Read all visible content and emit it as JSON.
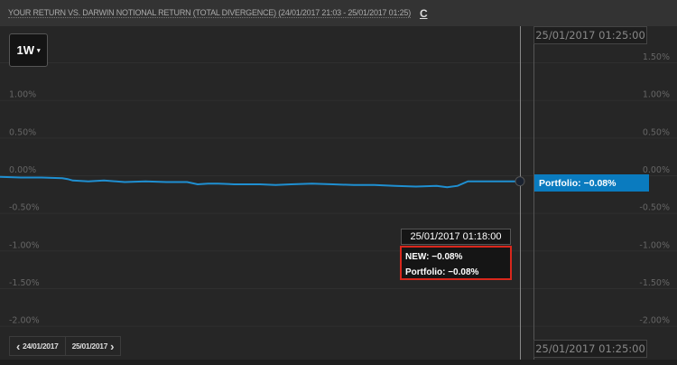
{
  "header": {
    "title": "YOUR RETURN VS. DARWIN NOTIONAL RETURN (TOTAL DIVERGENCE) (24/01/2017 21:03 - 25/01/2017 01:25)",
    "refresh_icon": "C"
  },
  "range_button": {
    "label": "1W",
    "caret": "▾"
  },
  "crosshair": {
    "date_top": "25/01/2017 01:25:00",
    "date_bottom": "25/01/2017 01:25:00",
    "badge": "Portfolio: −0.08%"
  },
  "tooltip": {
    "date": "25/01/2017 01:18:00",
    "new": "NEW: −0.08%",
    "portfolio": "Portfolio: −0.08%"
  },
  "nav": {
    "prev": "24/01/2017",
    "next": "25/01/2017",
    "prev_icon": "‹",
    "next_icon": "›"
  },
  "colors": {
    "line": "#1f8fd1",
    "badge": "#0a7bbf",
    "tooltip_border": "#d9271c"
  },
  "chart_data": {
    "type": "line",
    "title": "YOUR RETURN VS. DARWIN NOTIONAL RETURN (TOTAL DIVERGENCE)",
    "ylim": [
      -2.0,
      1.5
    ],
    "left_ticks": [
      "1.00%",
      "0.50%",
      "0.00%",
      "-0.50%",
      "-1.00%",
      "-1.50%",
      "-2.00%"
    ],
    "right_ticks": [
      "1.50%",
      "1.00%",
      "0.50%",
      "0.00%",
      "-0.50%",
      "-1.00%",
      "-1.50%",
      "-2.00%"
    ],
    "tick_values": [
      1.5,
      1.0,
      0.5,
      0.0,
      -0.5,
      -1.0,
      -1.5,
      -2.0
    ],
    "series": [
      {
        "name": "Portfolio",
        "x": [
          0,
          0.04,
          0.08,
          0.12,
          0.13,
          0.14,
          0.17,
          0.2,
          0.24,
          0.28,
          0.32,
          0.36,
          0.38,
          0.4,
          0.42,
          0.45,
          0.5,
          0.53,
          0.56,
          0.6,
          0.64,
          0.68,
          0.72,
          0.76,
          0.8,
          0.84,
          0.86,
          0.88,
          0.9,
          0.94,
          0.97,
          1.0
        ],
        "values": [
          -0.02,
          -0.03,
          -0.03,
          -0.04,
          -0.05,
          -0.07,
          -0.08,
          -0.07,
          -0.09,
          -0.08,
          -0.09,
          -0.09,
          -0.12,
          -0.11,
          -0.11,
          -0.12,
          -0.12,
          -0.13,
          -0.12,
          -0.11,
          -0.12,
          -0.13,
          -0.13,
          -0.14,
          -0.15,
          -0.14,
          -0.16,
          -0.14,
          -0.08,
          -0.08,
          -0.08,
          -0.08
        ]
      }
    ]
  }
}
